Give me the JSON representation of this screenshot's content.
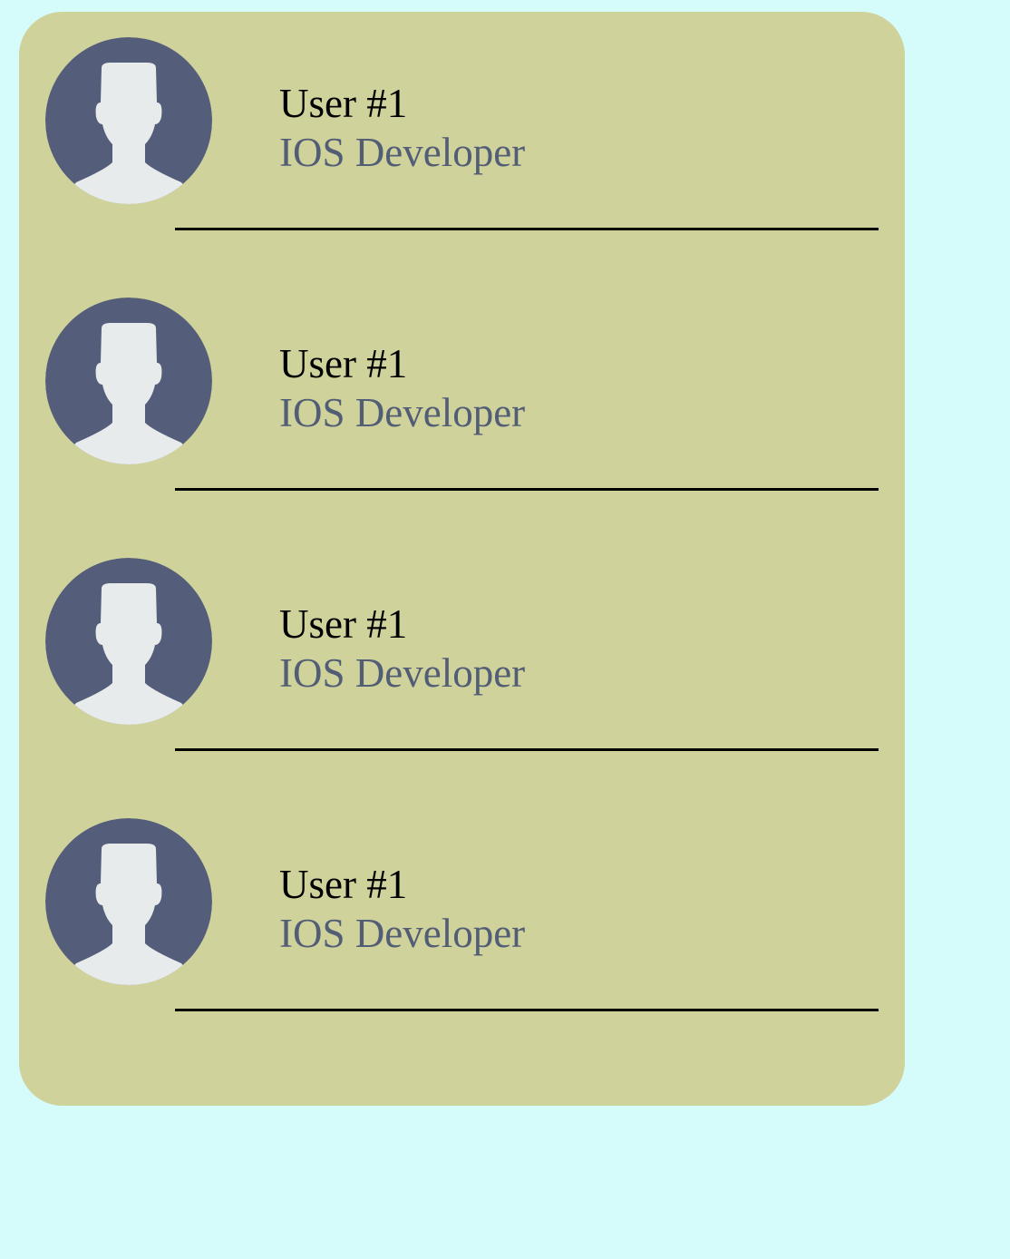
{
  "colors": {
    "page_background": "#d5fbfb",
    "card_background": "#d0d29b",
    "avatar_background": "#545e7a",
    "avatar_figure": "#e7ebec",
    "name_text": "#000000",
    "role_text": "#525d76",
    "divider": "#000000"
  },
  "users": [
    {
      "name": "User #1",
      "role": "IOS Developer",
      "icon": "user-avatar-icon"
    },
    {
      "name": "User #1",
      "role": "IOS Developer",
      "icon": "user-avatar-icon"
    },
    {
      "name": "User #1",
      "role": "IOS Developer",
      "icon": "user-avatar-icon"
    },
    {
      "name": "User #1",
      "role": "IOS Developer",
      "icon": "user-avatar-icon"
    }
  ]
}
